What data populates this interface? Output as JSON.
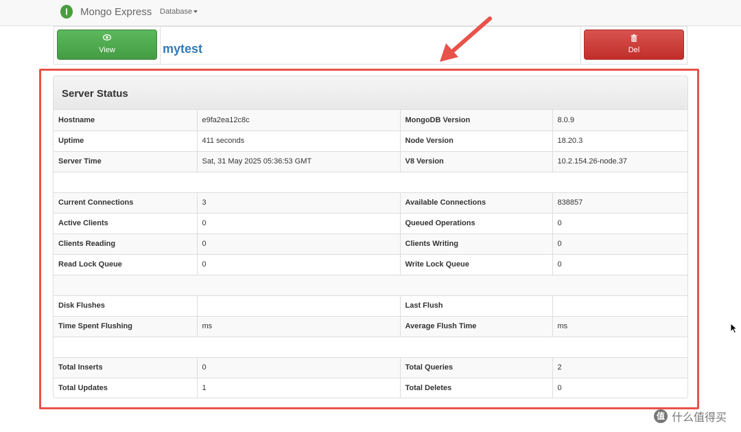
{
  "navbar": {
    "brand": "Mongo Express",
    "database_menu": "Database"
  },
  "actions": {
    "view_label": "View",
    "db_name": "mytest",
    "delete_label": "Del"
  },
  "server_status": {
    "title": "Server Status",
    "rows": [
      {
        "k1": "Hostname",
        "v1": "e9fa2ea12c8c",
        "k2": "MongoDB Version",
        "v2": "8.0.9"
      },
      {
        "k1": "Uptime",
        "v1": "411 seconds",
        "k2": "Node Version",
        "v2": "18.20.3"
      },
      {
        "k1": "Server Time",
        "v1": "Sat, 31 May 2025 05:36:53 GMT",
        "k2": "V8 Version",
        "v2": "10.2.154.26-node.37"
      },
      {
        "blank": true
      },
      {
        "k1": "Current Connections",
        "v1": "3",
        "k2": "Available Connections",
        "v2": "838857"
      },
      {
        "k1": "Active Clients",
        "v1": "0",
        "k2": "Queued Operations",
        "v2": "0"
      },
      {
        "k1": "Clients Reading",
        "v1": "0",
        "k2": "Clients Writing",
        "v2": "0"
      },
      {
        "k1": "Read Lock Queue",
        "v1": "0",
        "k2": "Write Lock Queue",
        "v2": "0"
      },
      {
        "blank": true
      },
      {
        "k1": "Disk Flushes",
        "v1": "",
        "k2": "Last Flush",
        "v2": ""
      },
      {
        "k1": "Time Spent Flushing",
        "v1": "ms",
        "k2": "Average Flush Time",
        "v2": "ms"
      },
      {
        "blank": true
      },
      {
        "k1": "Total Inserts",
        "v1": "0",
        "k2": "Total Queries",
        "v2": "2"
      },
      {
        "k1": "Total Updates",
        "v1": "1",
        "k2": "Total Deletes",
        "v2": "0"
      }
    ]
  },
  "watermark": {
    "badge": "值",
    "text": "什么值得买"
  },
  "colors": {
    "view_button": "#5cb85c",
    "delete_button": "#d9534f",
    "annotation": "#e8524a",
    "link": "#337ab7"
  }
}
